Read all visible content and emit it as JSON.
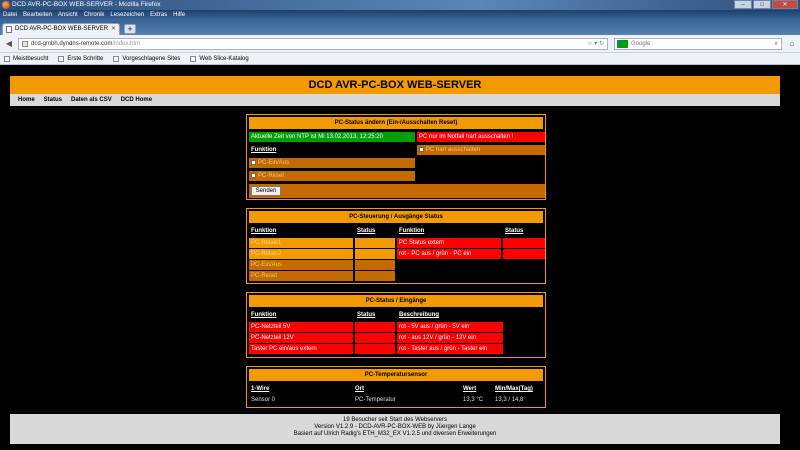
{
  "browser": {
    "window_title": "DCD AVR-PC-BOX WEB-SERVER - Mozilla Firefox",
    "menu": [
      "Datei",
      "Bearbeiten",
      "Ansicht",
      "Chronik",
      "Lesezeichen",
      "Extras",
      "Hilfe"
    ],
    "tab_title": "DCD AVR-PC-BOX WEB-SERVER",
    "url_host": "dcd-gmbh.dyndns-remote.com",
    "url_path": "/index.htm",
    "search_placeholder": "Google",
    "search_engine": "G",
    "bookmarks": [
      "Meistbesucht",
      "Erste Schritte",
      "Vorgeschlagene Sites",
      "Web Slice-Katalog"
    ]
  },
  "page": {
    "title": "DCD AVR-PC-BOX WEB-SERVER",
    "nav": [
      "Home",
      "Status",
      "Daten als CSV",
      "DCD Home"
    ]
  },
  "panel_status": {
    "title": "PC-Status ändern (Ein-/Ausschalten Reset)",
    "time": "Aktuelle Zeit von NTP ist Mi 13.02.2013, 12:25:20",
    "emergency": "PC nur im Notfall hart ausschalten !",
    "func_header": "Funktion",
    "hard_off": "PC hart ausschalten",
    "pc_on": "PC-Ein/Aus",
    "pc_reset": "PC-Reset",
    "send": "Senden"
  },
  "panel_outputs": {
    "title": "PC-Steuerung / Ausgänge Status",
    "col_func": "Funktion",
    "col_status": "Status",
    "left_rows": [
      "PC-Relais1",
      "PC-Relais2",
      "PC-Ein/Aus",
      "PC-Reset"
    ],
    "right_rows": [
      "PC Status extern",
      "rot - PC aus / grün - PC ein"
    ]
  },
  "panel_inputs": {
    "title": "PC-Status / Eingänge",
    "col_func": "Funktion",
    "col_status": "Status",
    "col_desc": "Beschreibung",
    "rows": [
      {
        "func": "PC-Netzteil 5V",
        "desc": "rot - 5V aus / grün - 5V ein"
      },
      {
        "func": "PC-Netzteil 12V",
        "desc": "rot - aus 12V / grün - 12V ein"
      },
      {
        "func": "Taster PC ein/aus extern",
        "desc": "rot - Taster aus / grün - Taster ein"
      }
    ]
  },
  "panel_temp": {
    "title": "PC-Temperatursensor",
    "col_wire": "1-Wire",
    "col_place": "Ort",
    "col_value": "Wert",
    "col_minmax": "Min/Max(Tag)",
    "sensor": "Sensor 0",
    "place": "PC-Temperatur",
    "value": "13,3  °C",
    "minmax": "13,3 / 14,8"
  },
  "footer": {
    "line1": "19 Besucher seit Start des Webservers",
    "line2": "Version V1.2.9 - DCD-AVR-PC-BOX-WEB by Jüergen Lange",
    "line3": "Basiert auf Ulrich Radig's ETH_M32_EX V1.2.5 und diversen Erweiterungen"
  },
  "colors": {
    "orange": "#f39a00",
    "dark_orange": "#c46a00",
    "red": "#ff0000",
    "green": "#00a000"
  }
}
